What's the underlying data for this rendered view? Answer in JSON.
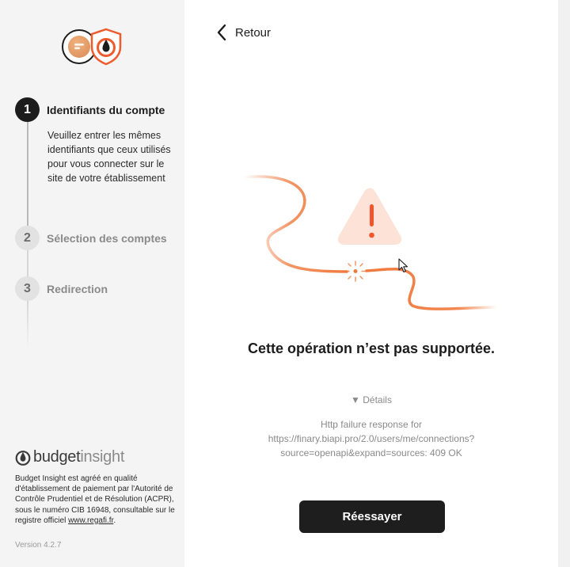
{
  "sidebar": {
    "logos": [
      "finary-logo",
      "budget-insight-logo"
    ],
    "steps": [
      {
        "number": "1",
        "title": "Identifiants du compte",
        "state": "active",
        "description": "Veuillez entrer les mêmes identifiants que ceux utilisés pour vous connecter sur le site de votre établissement"
      },
      {
        "number": "2",
        "title": "Sélection des comptes",
        "state": "inactive"
      },
      {
        "number": "3",
        "title": "Redirection",
        "state": "inactive"
      }
    ],
    "brand": {
      "part1": "budget",
      "part2": "insight"
    },
    "legal_text": "Budget Insight est agréé en qualité d'établissement de paiement par l'Autorité de Contrôle Prudentiel et de Résolution (ACPR), sous le numéro CIB 16948, consultable sur le registre officiel ",
    "legal_link": "www.regafi.fr",
    "legal_end": ".",
    "version": "Version 4.2.7"
  },
  "main": {
    "back_label": "Retour",
    "error_title": "Cette opération n’est pas supportée.",
    "details_toggle": "▼ Détails",
    "details_text": "Http failure response for https://finary.biapi.pro/2.0/users/me/connections?source=openapi&expand=sources: 409 OK",
    "retry_label": "Réessayer"
  },
  "colors": {
    "accent_orange": "#f07a3e",
    "warning_bg": "#fde3d7",
    "warning_fg": "#f2542d",
    "dark": "#1c1c1c",
    "sidebar_bg": "#f4f4f4"
  }
}
